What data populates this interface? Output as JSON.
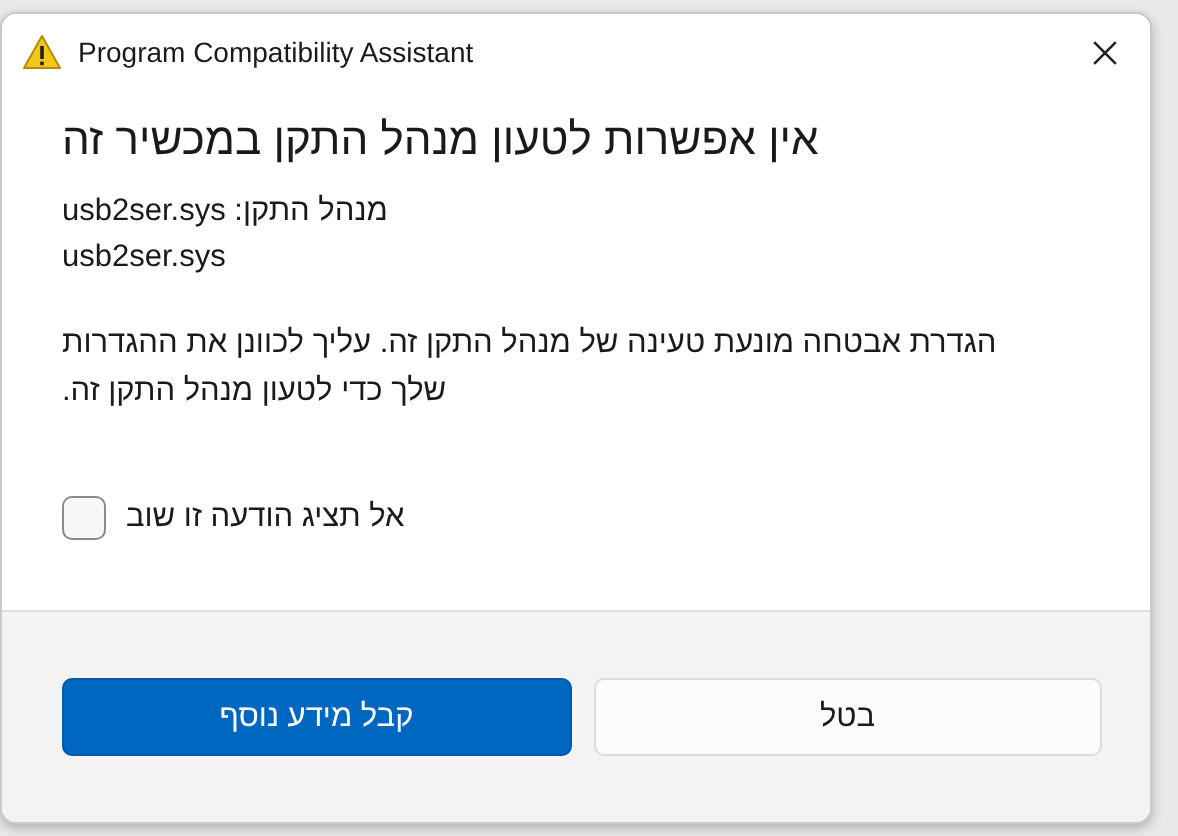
{
  "window": {
    "title": "Program Compatibility Assistant"
  },
  "heading": "אין אפשרות לטעון מנהל התקן במכשיר זה",
  "details": [
    "מנהל התקן: usb2ser.sys",
    "usb2ser.sys"
  ],
  "message": "הגדרת אבטחה מונעת טעינה של מנהל התקן זה. עליך לכוונן את ההגדרות שלך כדי לטעון מנהל התקן זה.",
  "checkbox": {
    "label": "אל תציג הודעה זו שוב",
    "checked": false
  },
  "buttons": [
    {
      "label": "בטל",
      "kind": "secondary"
    },
    {
      "label": "קבל מידע נוסף",
      "kind": "primary"
    }
  ]
}
